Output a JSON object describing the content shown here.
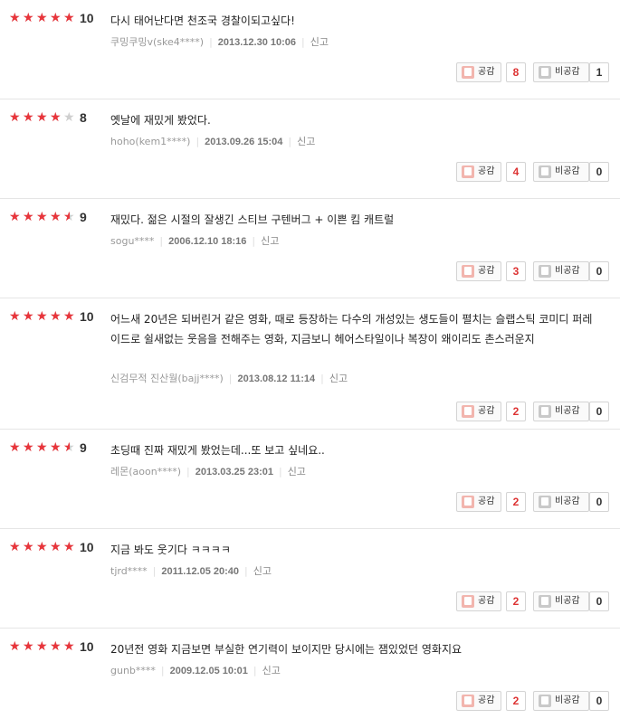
{
  "labels": {
    "like": "공감",
    "dislike": "비공감",
    "report": "신고"
  },
  "colors": {
    "star_on": "#e8353b",
    "star_off": "#cfcfcf",
    "like_count": "#dd3333"
  },
  "reviews": [
    {
      "rating": 10,
      "score_text": "10",
      "text": "다시 태어난다면 천조국 경찰이되고싶다!",
      "author": "쿠밍쿠밍v(ske4****)",
      "date": "2013.12.30 10:06",
      "likes": "8",
      "dislikes": "1"
    },
    {
      "rating": 8,
      "score_text": "8",
      "text": "옛날에 재밌게 봤었다.",
      "author": "hoho(kem1****)",
      "date": "2013.09.26 15:04",
      "likes": "4",
      "dislikes": "0"
    },
    {
      "rating": 9,
      "score_text": "9",
      "text": "재밌다. 젊은 시절의 잘생긴 스티브 구텐버그 + 이쁜 킴 캐트럴",
      "author": "sogu****",
      "date": "2006.12.10 18:16",
      "likes": "3",
      "dislikes": "0"
    },
    {
      "rating": 10,
      "score_text": "10",
      "text": "어느새 20년은 되버린거 같은 영화, 때로 등장하는 다수의 개성있는 생도들이 펼치는 슬랩스틱 코미디 퍼레이드로 쉴새없는 웃음을 전해주는 영화, 지금보니 헤어스타일이나 복장이 왜이리도 촌스러운지",
      "author": "신검무적 진산월(bajj****)",
      "date": "2013.08.12 11:14",
      "likes": "2",
      "dislikes": "0"
    },
    {
      "rating": 9,
      "score_text": "9",
      "text": "초딩때 진짜 재밌게 봤었는데...또 보고 싶네요..",
      "author": "레몬(aoon****)",
      "date": "2013.03.25 23:01",
      "likes": "2",
      "dislikes": "0"
    },
    {
      "rating": 10,
      "score_text": "10",
      "text": "지금 봐도 웃기다 ㅋㅋㅋㅋ",
      "author": "tjrd****",
      "date": "2011.12.05 20:40",
      "likes": "2",
      "dislikes": "0"
    },
    {
      "rating": 10,
      "score_text": "10",
      "text": "20년전 영화 지금보면 부실한 연기력이 보이지만 당시에는 잼있었던 영화지요",
      "author": "gunb****",
      "date": "2009.12.05 10:01",
      "likes": "2",
      "dislikes": "0"
    }
  ]
}
